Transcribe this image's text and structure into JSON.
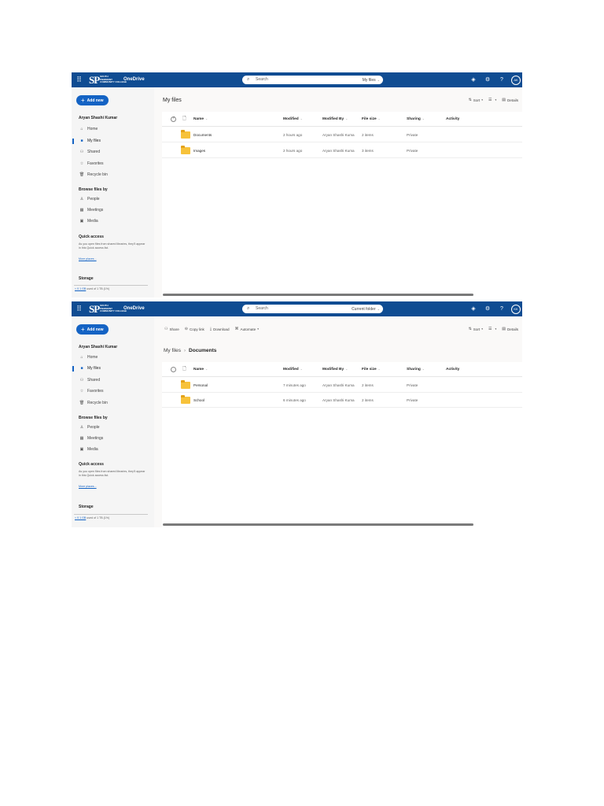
{
  "brand": {
    "logo_text": "SP",
    "logo_sub": [
      "SOUTH",
      "PIEDMONT",
      "COMMUNITY COLLEGE"
    ],
    "app_name": "OneDrive"
  },
  "colors": {
    "topbar": "#0f4c92",
    "accent": "#1463c4",
    "folder": "#f7c23a"
  },
  "icons": {
    "waffle": "app-launcher-icon",
    "search": "search-icon",
    "premium": "diamond-icon",
    "settings": "gear-icon",
    "help": "help-icon"
  },
  "sidebar": {
    "add_new": "Add new",
    "user_name": "Aryan Shashi Kumar",
    "nav": [
      {
        "label": "Home",
        "icon": "home-icon"
      },
      {
        "label": "My files",
        "icon": "folder-icon"
      },
      {
        "label": "Shared",
        "icon": "shared-icon"
      },
      {
        "label": "Favorites",
        "icon": "star-icon"
      },
      {
        "label": "Recycle bin",
        "icon": "trash-icon"
      }
    ],
    "browse_title": "Browse files by",
    "browse": [
      {
        "label": "People",
        "icon": "person-icon"
      },
      {
        "label": "Meetings",
        "icon": "calendar-icon"
      },
      {
        "label": "Media",
        "icon": "image-icon"
      }
    ],
    "quick_access_title": "Quick access",
    "quick_access_text": "As you open files from shared libraries, they'll appear in this Quick access list.",
    "quick_access_link": "More places...",
    "storage_title": "Storage",
    "storage_used": "< 0.1 GB",
    "storage_rest": " used of 1 TB (1%)"
  },
  "columns": {
    "name": "Name",
    "modified": "Modified",
    "modified_by": "Modified By",
    "file_size": "File size",
    "sharing": "Sharing",
    "activity": "Activity"
  },
  "toolbar": {
    "sort": "Sort",
    "details": "Details",
    "share": "Share",
    "copy_link": "Copy link",
    "download": "Download",
    "automate": "Automate"
  },
  "screens": [
    {
      "avatar": "AK",
      "search_placeholder": "Search",
      "search_scope": "My files",
      "page_title": "My files",
      "files": [
        {
          "name": "Documents",
          "modified": "2 hours ago",
          "modified_by": "Aryan Shashi Kuma",
          "file_size": "2 items",
          "sharing": "Private"
        },
        {
          "name": "Images",
          "modified": "2 hours ago",
          "modified_by": "Aryan Shashi Kuma",
          "file_size": "3 items",
          "sharing": "Private"
        }
      ]
    },
    {
      "avatar": "KK",
      "search_placeholder": "Search",
      "search_scope": "Current folder",
      "breadcrumb_root": "My files",
      "breadcrumb_current": "Documents",
      "files": [
        {
          "name": "Personal",
          "modified": "7 minutes ago",
          "modified_by": "Aryan Shashi Kuma",
          "file_size": "2 items",
          "sharing": "Private"
        },
        {
          "name": "School",
          "modified": "6 minutes ago",
          "modified_by": "Aryan Shashi Kuma",
          "file_size": "2 items",
          "sharing": "Private"
        }
      ]
    }
  ]
}
